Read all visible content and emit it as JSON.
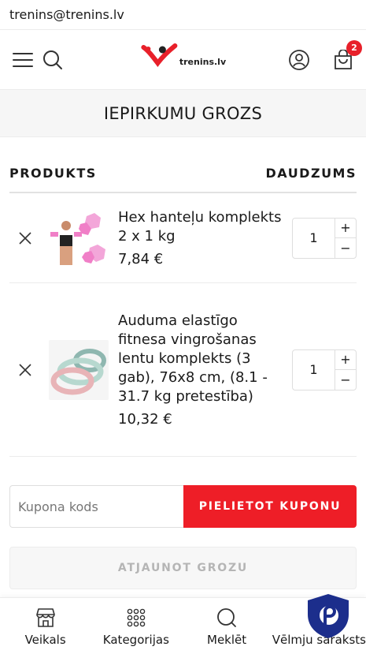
{
  "topbar": {
    "email": "trenins@trenins.lv"
  },
  "header": {
    "logo_text": "trenins.lv",
    "cart_count": "2"
  },
  "page": {
    "title": "IEPIRKUMU GROZS"
  },
  "table": {
    "col_product": "PRODUKTS",
    "col_quantity": "DAUDZUMS"
  },
  "cart": {
    "items": [
      {
        "name": "Hex hanteļu komplekts 2 x 1 kg",
        "price": "7,84 €",
        "quantity": "1"
      },
      {
        "name": "Auduma elastīgo fitnesa vingrošanas lentu komplekts (3 gab), 76x8 cm, (8.1 - 31.7 kg pretestība)",
        "price": "10,32 €",
        "quantity": "1"
      }
    ]
  },
  "qty_controls": {
    "plus": "+",
    "minus": "−"
  },
  "coupon": {
    "placeholder": "Kupona kods",
    "button_label": "PIELIETOT KUPONU"
  },
  "update": {
    "button_label": "ATJAUNOT GROZU"
  },
  "bottom_nav": {
    "items": [
      {
        "label": "Veikals",
        "icon": "store-icon"
      },
      {
        "label": "Kategorijas",
        "icon": "grid-dots-icon"
      },
      {
        "label": "Meklēt",
        "icon": "search-icon"
      },
      {
        "label": "Vēlmju saraksts",
        "icon": "heart-icon"
      }
    ]
  },
  "colors": {
    "accent": "#ee1e27",
    "badge": "#e8202a",
    "shield": "#1c2e8c"
  }
}
